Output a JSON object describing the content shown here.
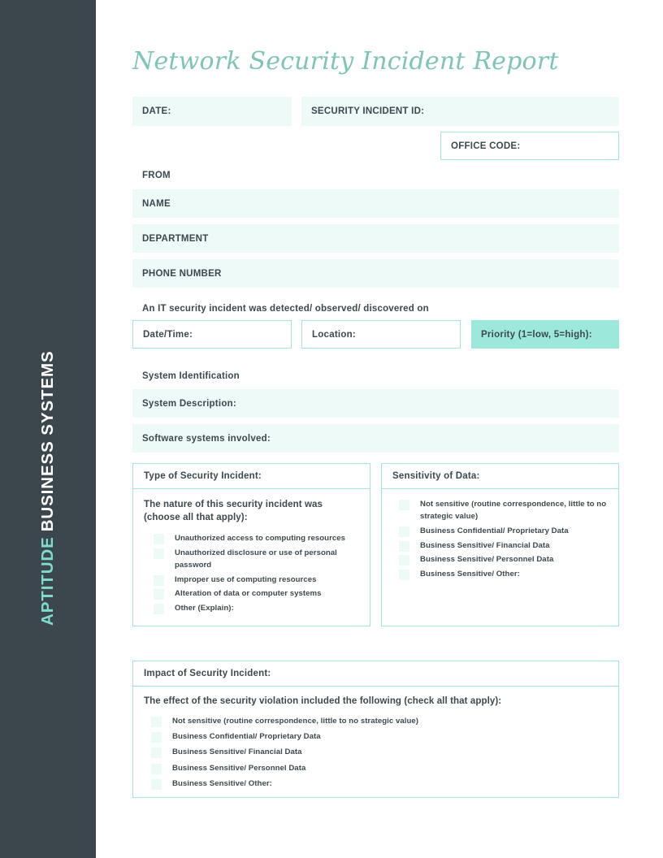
{
  "sidebar": {
    "brand_accent": "APTITUDE",
    "brand_plain": "BUSINESS SYSTEMS",
    "background_color": "#3b474d",
    "accent_color": "#7fdbcb"
  },
  "document": {
    "title": "Network Security Incident Report",
    "title_color": "#7fc4b8"
  },
  "header_fields": {
    "date": "DATE:",
    "incident_id": "SECURITY INCIDENT ID:",
    "office_code": "OFFICE CODE:"
  },
  "from_section": {
    "label": "FROM",
    "name": "NAME",
    "department": "DEPARTMENT",
    "phone_number": "PHONE NUMBER"
  },
  "detection_section": {
    "heading": "An IT security incident was detected/ observed/ discovered on",
    "date_time": "Date/Time:",
    "location": "Location:",
    "priority": "Priority (1=low, 5=high):",
    "priority_fill_color": "#9ce9dc"
  },
  "system_identification": {
    "heading": "System Identification",
    "system_description": "System Description:",
    "software_systems": "Software systems involved:"
  },
  "type_panel": {
    "header": "Type of Security Incident:",
    "intro": "The nature of this security incident was (choose all that apply):",
    "options": [
      "Unauthorized access to computing resources",
      "Unauthorized disclosure or use of personal password",
      "Improper use of computing resources",
      "Alteration of data or computer systems",
      "Other (Explain):"
    ]
  },
  "sensitivity_panel": {
    "header": "Sensitivity of Data:",
    "options": [
      "Not sensitive (routine correspondence, little to no strategic value)",
      "Business Confidential/ Proprietary Data",
      "Business Sensitive/ Financial Data",
      "Business Sensitive/ Personnel Data",
      "Business Sensitive/ Other:"
    ]
  },
  "impact_panel": {
    "header": "Impact of Security Incident:",
    "intro": "The effect of the security violation included the following (check all that apply):",
    "options": [
      "Not sensitive (routine correspondence, little to no strategic value)",
      "Business Confidential/ Proprietary Data",
      "Business Sensitive/ Financial Data",
      "Business Sensitive/ Personnel Data",
      "Business Sensitive/ Other:"
    ]
  },
  "theme": {
    "field_fill": "#edfaf8",
    "border": "#a4e3d8",
    "text": "#3d484e"
  }
}
